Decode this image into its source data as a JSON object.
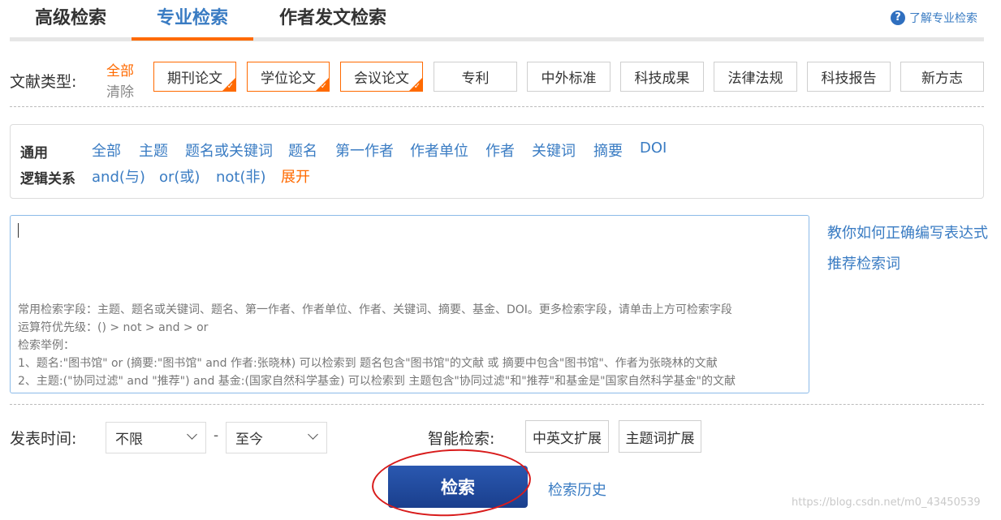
{
  "tabs": [
    {
      "label": "高级检索",
      "active": false
    },
    {
      "label": "专业检索",
      "active": true
    },
    {
      "label": "作者发文检索",
      "active": false
    }
  ],
  "help": {
    "icon": "question-icon",
    "label": "了解专业检索"
  },
  "doc_types": {
    "label": "文献类型:",
    "select_all": "全部",
    "clear": "清除",
    "items": [
      {
        "label": "期刊论文",
        "selected": true
      },
      {
        "label": "学位论文",
        "selected": true
      },
      {
        "label": "会议论文",
        "selected": true
      },
      {
        "label": "专利",
        "selected": false
      },
      {
        "label": "中外标准",
        "selected": false
      },
      {
        "label": "科技成果",
        "selected": false
      },
      {
        "label": "法律法规",
        "selected": false
      },
      {
        "label": "科技报告",
        "selected": false
      },
      {
        "label": "新方志",
        "selected": false
      }
    ]
  },
  "fields": {
    "general_label": "通用",
    "general": [
      "全部",
      "主题",
      "题名或关键词",
      "题名",
      "第一作者",
      "作者单位",
      "作者",
      "关键词",
      "摘要",
      "DOI"
    ],
    "logic_label": "逻辑关系",
    "logic": [
      "and(与)",
      "or(或)",
      "not(非)"
    ],
    "expand": "展开"
  },
  "editor": {
    "hints": [
      "常用检索字段：主题、题名或关键词、题名、第一作者、作者单位、作者、关键词、摘要、基金、DOI。更多检索字段，请单击上方可检索字段",
      "运算符优先级：() > not > and > or",
      "检索举例：",
      "1、题名:\"图书馆\" or (摘要:\"图书馆\" and 作者:张晓林) 可以检索到 题名包含\"图书馆\"的文献 或 摘要中包含\"图书馆\"、作者为张晓林的文献",
      "2、主题:(\"协同过滤\" and \"推荐\") and 基金:(国家自然科学基金) 可以检索到 主题包含\"协同过滤\"和\"推荐\"和基金是\"国家自然科学基金\"的文献"
    ]
  },
  "side_links": [
    "教你如何正确编写表达式",
    "推荐检索词"
  ],
  "publish_time": {
    "label": "发表时间:",
    "from": "不限",
    "separator": "-",
    "to": "至今"
  },
  "smart_search": {
    "label": "智能检索:",
    "options": [
      "中英文扩展",
      "主题词扩展"
    ]
  },
  "search_button": "检索",
  "history_link": "检索历史",
  "watermark": "https://blog.csdn.net/m0_43450539",
  "colors": {
    "accent": "#ff6a00",
    "link": "#3a7cc3",
    "button": "#1f4a9e",
    "annotation": "#d81b1b"
  }
}
